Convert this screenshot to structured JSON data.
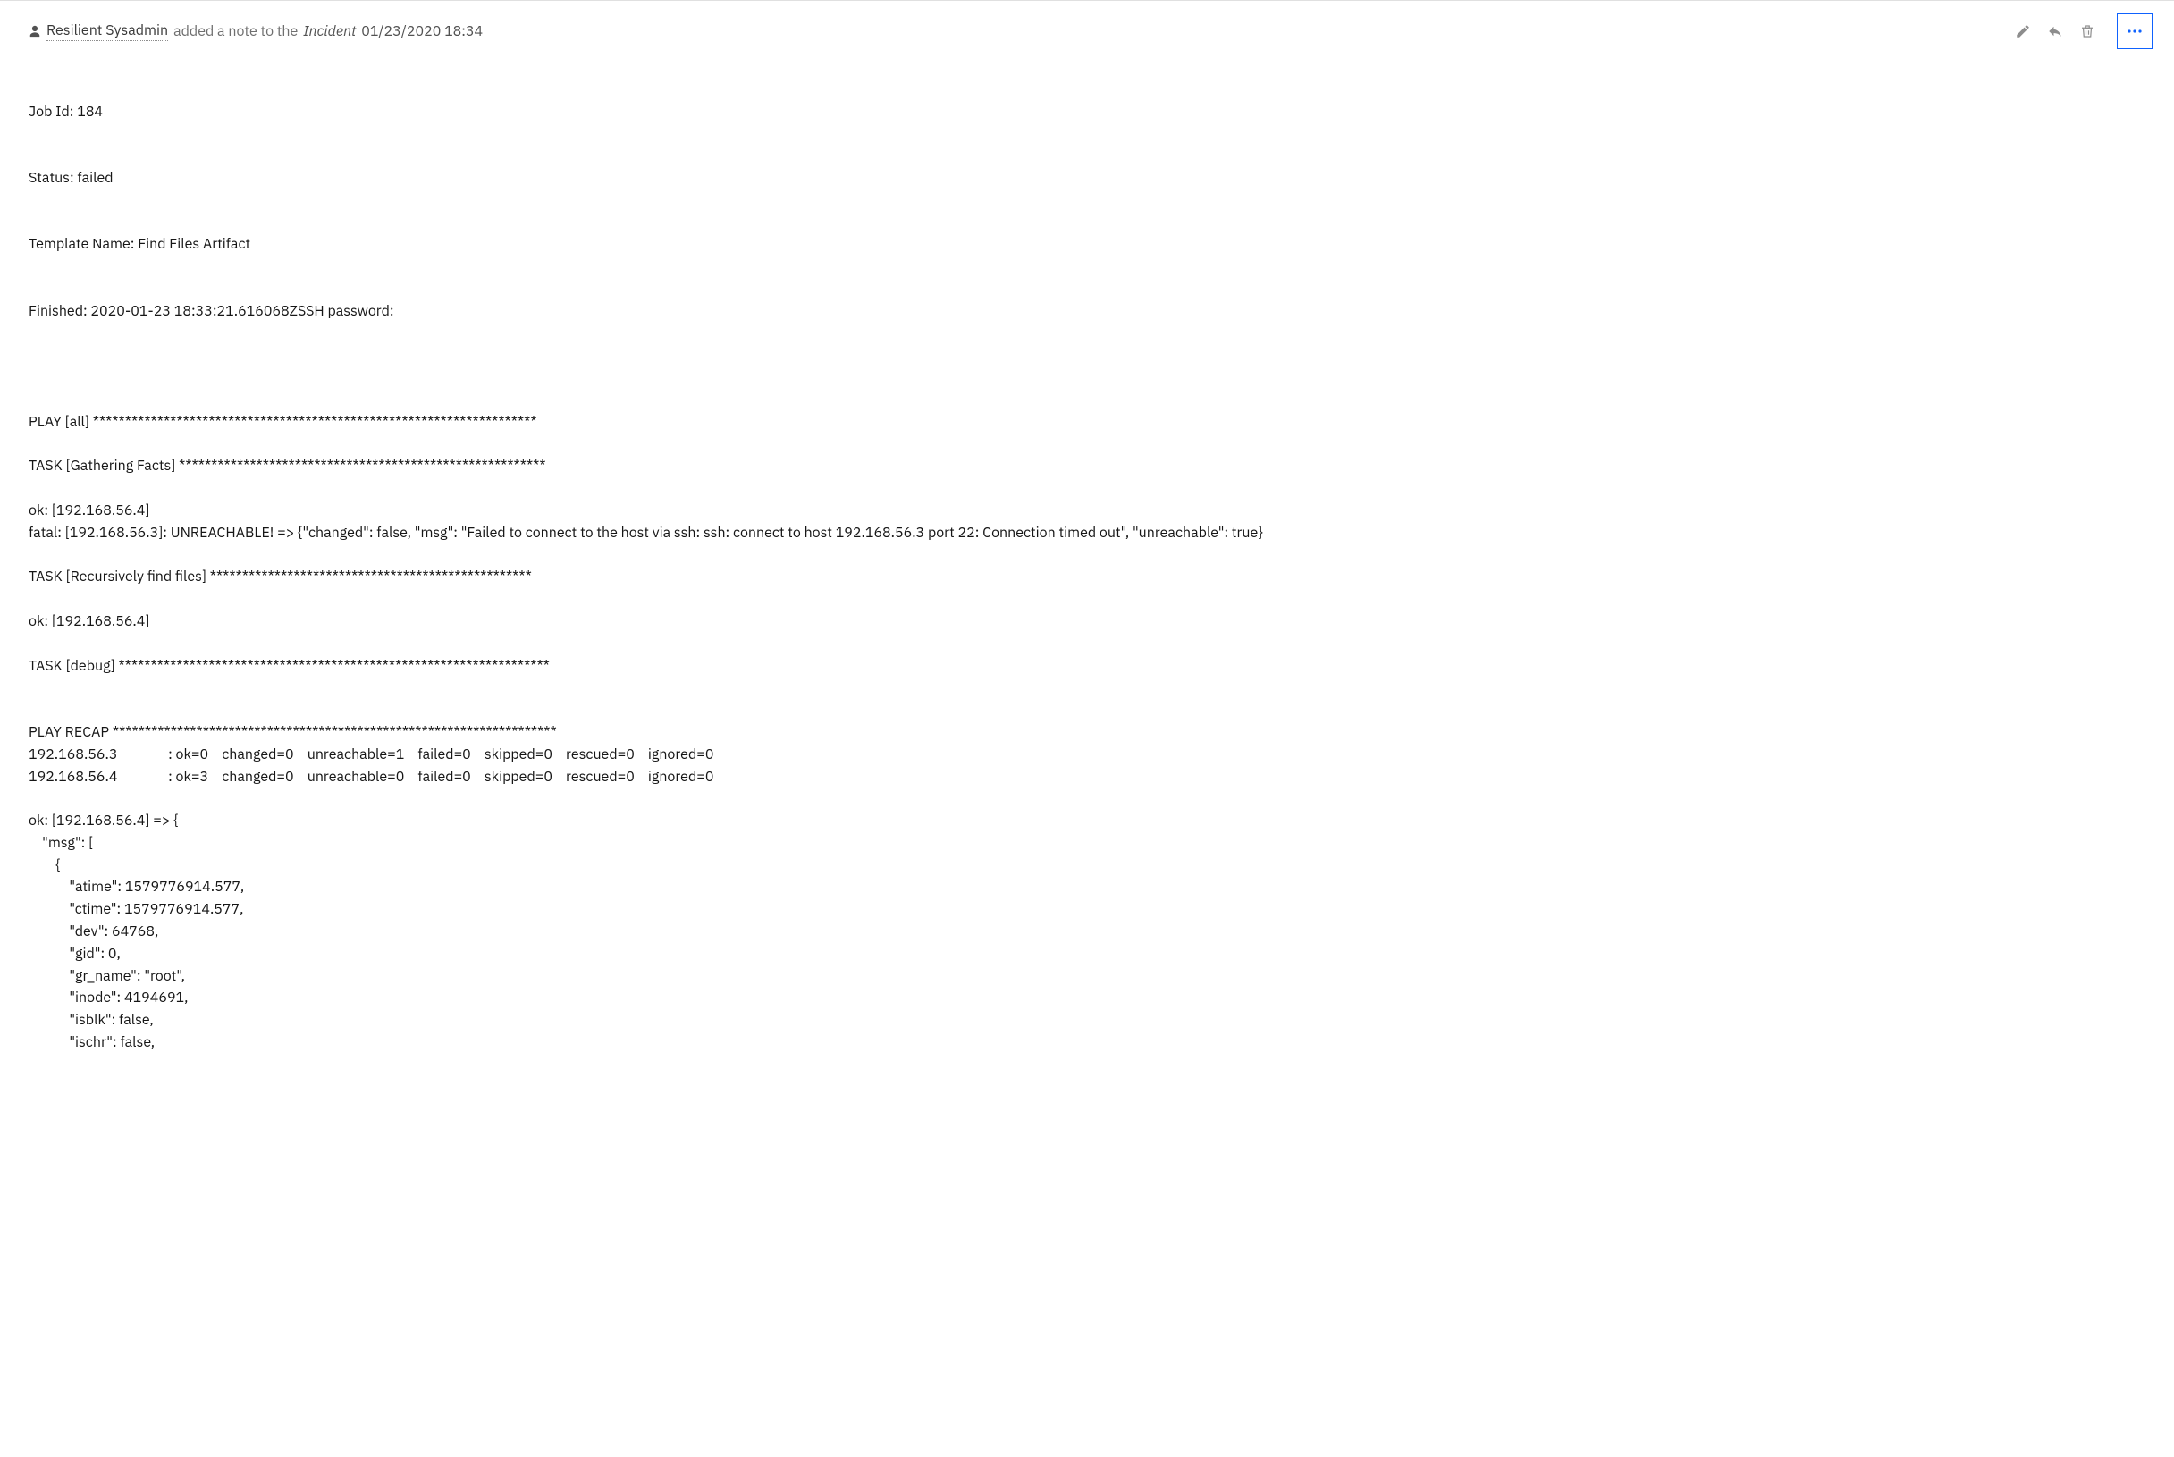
{
  "header": {
    "user": "Resilient Sysadmin",
    "phrase": "added a note to the",
    "target": "Incident",
    "timestamp": "01/23/2020 18:34"
  },
  "meta": {
    "line1": "Job Id: 184",
    "line2": "Status: failed",
    "line3": "Template Name: Find Files Artifact",
    "line4": "Finished: 2020-01-23 18:33:21.616068ZSSH password:"
  },
  "output": "\n\nPLAY [all] *********************************************************************\n\nTASK [Gathering Facts] *********************************************************\n\nok: [192.168.56.4]\nfatal: [192.168.56.3]: UNREACHABLE! => {\"changed\": false, \"msg\": \"Failed to connect to the host via ssh: ssh: connect to host 192.168.56.3 port 22: Connection timed out\", \"unreachable\": true}\n\nTASK [Recursively find files] **************************************************\n\nok: [192.168.56.4]\n\nTASK [debug] *******************************************************************\n\n\nPLAY RECAP *********************************************************************\n192.168.56.3               : ok=0    changed=0    unreachable=1    failed=0    skipped=0    rescued=0    ignored=0\n192.168.56.4               : ok=3    changed=0    unreachable=0    failed=0    skipped=0    rescued=0    ignored=0\n\nok: [192.168.56.4] => {\n    \"msg\": [\n        {\n            \"atime\": 1579776914.577,\n            \"ctime\": 1579776914.577,\n            \"dev\": 64768,\n            \"gid\": 0,\n            \"gr_name\": \"root\",\n            \"inode\": 4194691,\n            \"isblk\": false,\n            \"ischr\": false,"
}
